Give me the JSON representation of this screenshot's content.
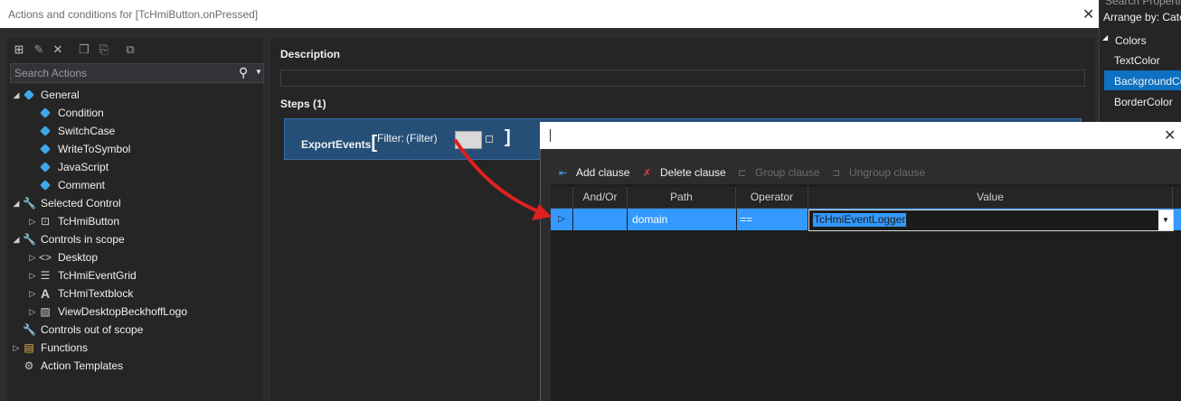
{
  "dialog": {
    "title": "Actions and conditions for [TcHmiButton.onPressed]",
    "close_glyph": "✕"
  },
  "right_pane": {
    "search_partial": "Search Properties",
    "arrange_label": "Arrange by:",
    "arrange_value": "Cate",
    "category": "Colors",
    "items": [
      "TextColor",
      "BackgroundCo",
      "BorderColor"
    ],
    "selected_index": 1
  },
  "left": {
    "search_placeholder": "Search Actions",
    "tree": {
      "general": {
        "label": "General",
        "children": [
          "Condition",
          "SwitchCase",
          "WriteToSymbol",
          "JavaScript",
          "Comment"
        ]
      },
      "selected_control": {
        "label": "Selected Control",
        "children": [
          "TcHmiButton"
        ]
      },
      "controls_in_scope": {
        "label": "Controls in scope",
        "children": [
          "Desktop",
          "TcHmiEventGrid",
          "TcHmiTextblock",
          "ViewDesktopBeckhoffLogo"
        ]
      },
      "controls_out_of_scope": "Controls out of scope",
      "functions": "Functions",
      "action_templates": "Action Templates"
    }
  },
  "main": {
    "description_label": "Description",
    "description_value": "",
    "steps_label": "Steps (1)",
    "step": {
      "name": "ExportEvents",
      "open_bracket": "[",
      "close_bracket": "]",
      "filter_label": "Filter:",
      "filter_value": "(Filter)"
    }
  },
  "filter_editor": {
    "close_glyph": "✕",
    "toolbar": {
      "add": "Add clause",
      "delete": "Delete clause",
      "group": "Group clause",
      "ungroup": "Ungroup clause"
    },
    "columns": [
      "And/Or",
      "Path",
      "Operator",
      "Value"
    ],
    "rows": [
      {
        "and_or": "",
        "path": "domain",
        "operator": "==",
        "value": "TcHmiEventLogger"
      }
    ]
  },
  "colors": {
    "accent": "#3399ff",
    "selection": "#0e70c0",
    "step_bg": "#264f78",
    "arrow": "#e02020"
  }
}
